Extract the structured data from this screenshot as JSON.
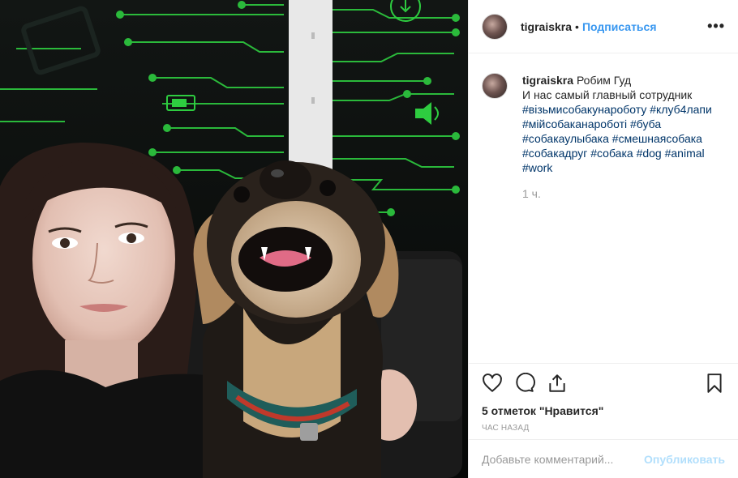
{
  "post": {
    "username": "tigraiskra",
    "separator": "•",
    "follow_label": "Подписаться",
    "more_label": "•••",
    "caption": {
      "username": "tigraiskra",
      "text_line1": "Робим Гуд",
      "text_line2": "И нас самый главный сотрудник",
      "hashtags": [
        "#візьмисобакунароботу",
        "#клуб4лапи",
        "#мійсобаканароботі",
        "#буба",
        "#собакаулыбака",
        "#смешнаясобака",
        "#собакадруг",
        "#собака",
        "#dog",
        "#animal",
        "#work"
      ]
    },
    "caption_time": "1 ч.",
    "likes_text": "5 отметок \"Нравится\"",
    "posted_ago": "час назад",
    "comment": {
      "placeholder": "Добавьте комментарий...",
      "value": "",
      "publish_label": "Опубликовать"
    },
    "icons": {
      "like": "heart-icon",
      "comment": "comment-icon",
      "share": "share-icon",
      "save": "bookmark-icon"
    },
    "colors": {
      "link": "#3897f0",
      "hashtag": "#003569",
      "muted": "#999999",
      "publish_disabled": "#b2dffc",
      "circuit_green": "#2ecc40"
    }
  }
}
